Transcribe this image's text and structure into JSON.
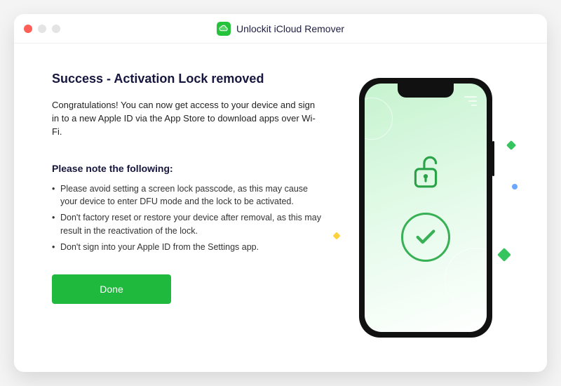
{
  "titlebar": {
    "app_name": "Unlockit iCloud Remover"
  },
  "main": {
    "heading": "Success - Activation Lock removed",
    "intro": "Congratulations! You can now get access to your device and sign in to a new Apple ID via the App Store to download apps over Wi-Fi.",
    "note_heading": "Please note the following:",
    "notes": [
      "Please avoid setting a screen lock passcode, as this may cause your device to enter DFU mode and the lock to be activated.",
      "Don't factory reset or restore your device after removal, as this may result in the reactivation of the lock.",
      "Don't sign into your Apple ID from the Settings app."
    ],
    "done_label": "Done"
  },
  "colors": {
    "accent": "#1fb93d",
    "heading": "#16163f"
  },
  "illustration": {
    "lock_icon": "unlocked-padlock-icon",
    "status_icon": "checkmark-circle-icon"
  }
}
